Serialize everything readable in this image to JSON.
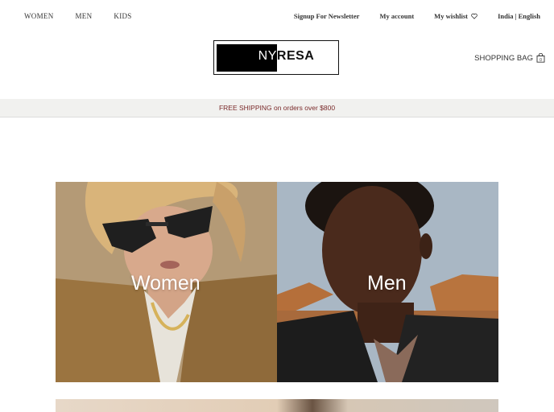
{
  "topnav": {
    "left": [
      "WOMEN",
      "MEN",
      "KIDS"
    ],
    "newsletter": "Signup For Newsletter",
    "account": "My account",
    "wishlist": "My wishlist",
    "locale": "India | English"
  },
  "logo": {
    "part1": "NY",
    "part2": "RESA"
  },
  "bag": {
    "label": "SHOPPING BAG",
    "count": "0"
  },
  "shipping": {
    "text": "FREE SHIPPING on orders over $800"
  },
  "hero": {
    "women_label": "Women",
    "men_label": "Men"
  },
  "colors": {
    "shipping_text": "#7a2a2a",
    "shipping_bg": "#f1f1ef"
  }
}
